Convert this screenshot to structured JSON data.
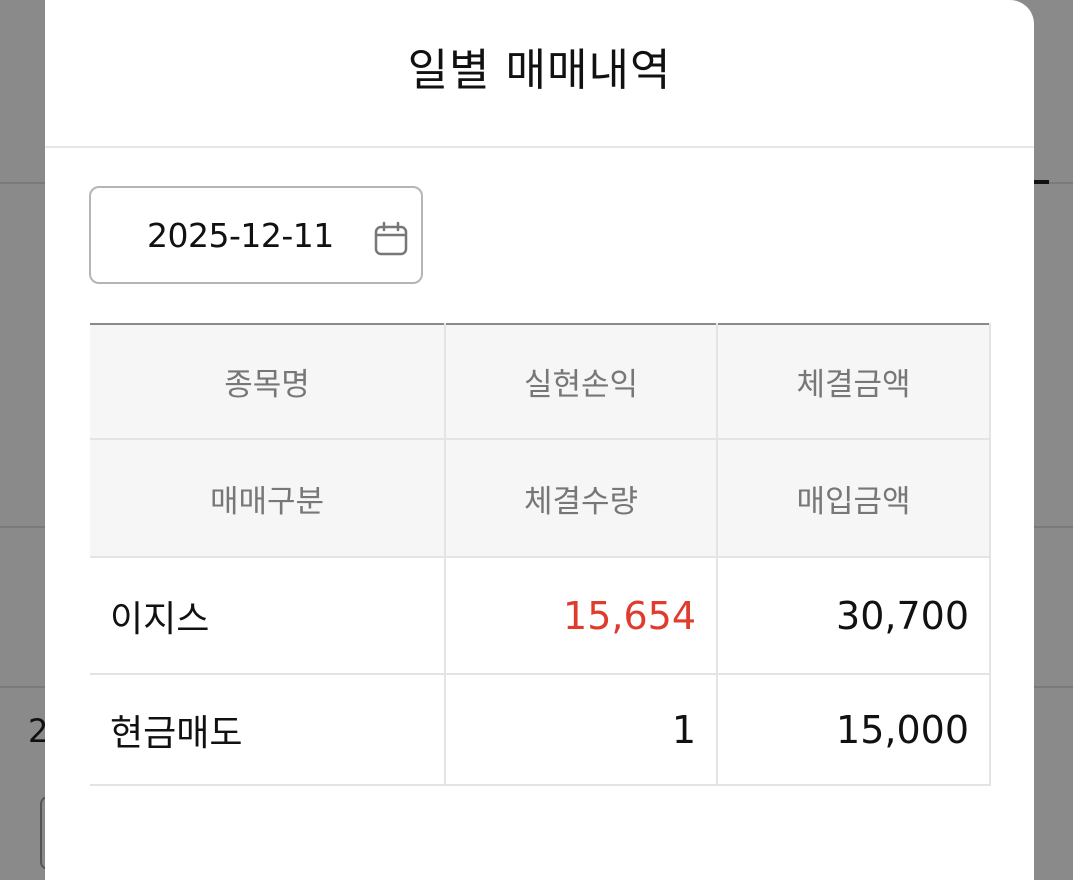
{
  "background": {
    "partial_text": "2"
  },
  "modal": {
    "title": "일별 매매내역",
    "date": "2025-12-11",
    "date_icon": "calendar-icon",
    "headers_row1": [
      "종목명",
      "실현손익",
      "체결금액"
    ],
    "headers_row2": [
      "매매구분",
      "체결수량",
      "매입금액"
    ],
    "rows": [
      {
        "c1": "이지스",
        "c2": "15,654",
        "c3": "30,700"
      },
      {
        "c1": "현금매도",
        "c2": "1",
        "c3": "15,000"
      }
    ],
    "colors": {
      "profit": "#e03b2d",
      "header_bg": "#f6f6f6"
    }
  }
}
